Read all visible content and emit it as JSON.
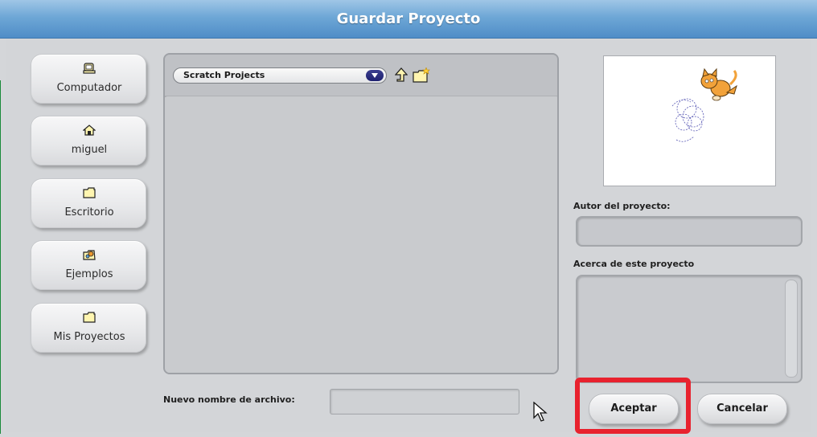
{
  "dialog": {
    "title": "Guardar Proyecto"
  },
  "locations": [
    {
      "label": "Computador",
      "icon": "computer-icon"
    },
    {
      "label": "miguel",
      "icon": "home-icon"
    },
    {
      "label": "Escritorio",
      "icon": "folder-icon"
    },
    {
      "label": "Ejemplos",
      "icon": "examples-folder-icon"
    },
    {
      "label": "Mis Proyectos",
      "icon": "folder-icon"
    }
  ],
  "browser": {
    "folder_selected": "Scratch Projects"
  },
  "author_label": "Autor del proyecto:",
  "author_value": "",
  "about_label": "Acerca de este proyecto",
  "about_value": "",
  "filename_label": "Nuevo nombre de archivo:",
  "filename_value": "",
  "buttons": {
    "accept": "Aceptar",
    "cancel": "Cancelar"
  },
  "colors": {
    "titlebar": "#5f9bd0",
    "highlight": "#e8222e",
    "dialog_bg": "#d3d5d8"
  }
}
